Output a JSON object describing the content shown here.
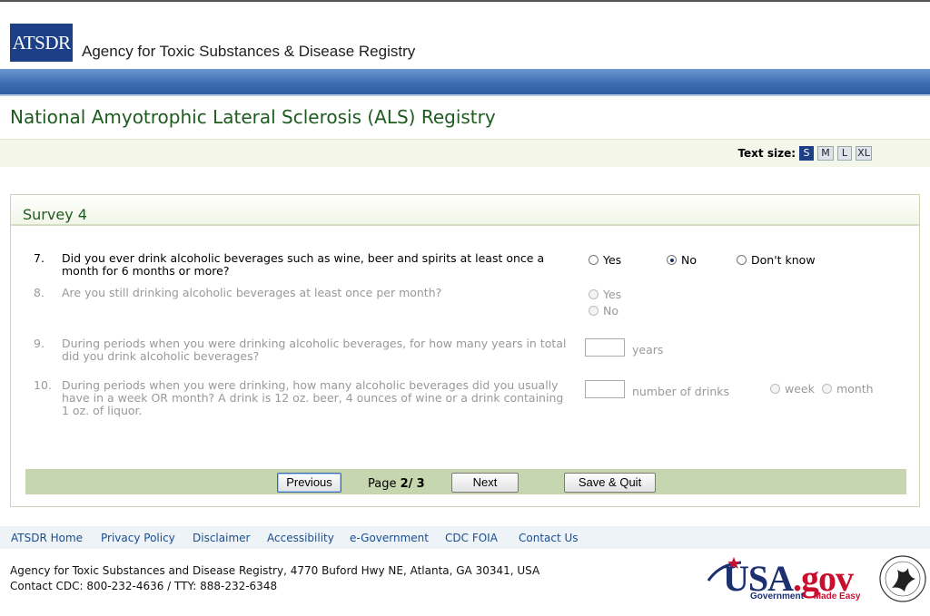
{
  "header": {
    "logo_text": "ATSDR",
    "agency_name": "Agency for Toxic Substances & Disease Registry"
  },
  "page_title": "National Amyotrophic Lateral Sclerosis (ALS) Registry",
  "text_size": {
    "label": "Text size:",
    "options": [
      "S",
      "M",
      "L",
      "XL"
    ],
    "selected": "S"
  },
  "survey": {
    "title": "Survey 4",
    "questions": [
      {
        "num": "7.",
        "line1": "Did you ever drink alcoholic beverages such as wine, beer and spirits at least once a",
        "line2": "month for 6 months or more?",
        "options": [
          "Yes",
          "No",
          "Don't know"
        ],
        "selected": "No"
      },
      {
        "num": "8.",
        "line1": "Are you still drinking alcoholic beverages at least once per month?",
        "options": [
          "Yes",
          "No"
        ]
      },
      {
        "num": "9.",
        "line1": "During periods when you were drinking alcoholic beverages, for how many years in total",
        "line2": "did you drink alcoholic beverages?",
        "unit": "years"
      },
      {
        "num": "10.",
        "line1": "During periods when you were drinking, how many alcoholic beverages did you usually",
        "line2": "have in a week OR month? A drink is 12 oz. beer, 4 ounces of wine or a drink containing",
        "line3": "1 oz. of liquor.",
        "unit": "number of drinks",
        "period_options": [
          "week",
          "month"
        ]
      }
    ]
  },
  "pager": {
    "previous_label": "Previous",
    "page_label": "Page",
    "current_page": "2",
    "separator": "/",
    "total_pages": "3",
    "next_label": "Next",
    "save_quit_label": "Save & Quit"
  },
  "footer": {
    "links": [
      "ATSDR Home",
      "Privacy Policy",
      "Disclaimer",
      "Accessibility",
      "e-Government",
      "CDC FOIA",
      "Contact Us"
    ],
    "address_line": "Agency for Toxic Substances and Disease Registry, 4770 Buford Hwy NE, Atlanta, GA 30341, USA",
    "contact_line": "Contact CDC: 800-232-4636 / TTY: 888-232-6348",
    "usagov_main": "USA",
    "usagov_suffix": ".gov",
    "usagov_tagline_1": "Government",
    "usagov_tagline_2": "Made Easy"
  },
  "colors": {
    "brand_blue": "#1c3f86",
    "title_green": "#1e5b1e",
    "nav_green": "#c6d6ae",
    "link_blue": "#1b4d8c"
  }
}
